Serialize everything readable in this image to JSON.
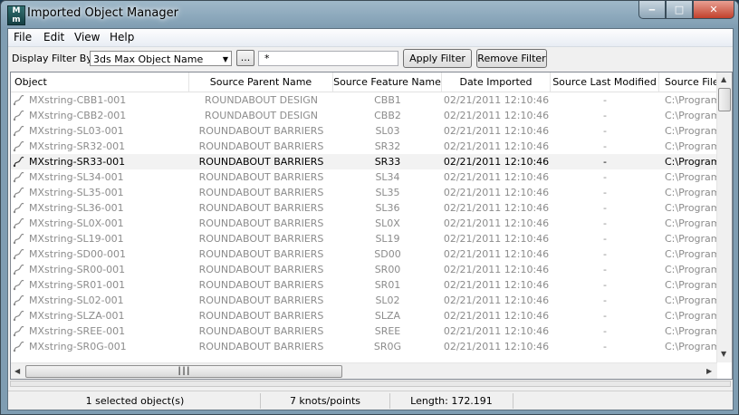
{
  "window": {
    "title": "Imported Object Manager"
  },
  "menu": [
    "File",
    "Edit",
    "View",
    "Help"
  ],
  "toolbar": {
    "filter_label": "Display Filter By:",
    "filter_by_value": "3ds Max Object Name",
    "browse_label": "...",
    "filter_text": "*",
    "apply_label": "Apply Filter",
    "remove_label": "Remove Filter"
  },
  "table": {
    "columns": [
      "Object",
      "Source Parent Name",
      "Source Feature Name",
      "Date Imported",
      "Source Last Modified",
      "Source File"
    ],
    "rows": [
      {
        "object": "MXstring-CBB1-001",
        "parent": "ROUNDABOUT DESIGN",
        "feature": "CBB1",
        "date": "02/21/2011 12:10:46",
        "modified": "-",
        "file": "C:\\Program"
      },
      {
        "object": "MXstring-CBB2-001",
        "parent": "ROUNDABOUT DESIGN",
        "feature": "CBB2",
        "date": "02/21/2011 12:10:46",
        "modified": "-",
        "file": "C:\\Program"
      },
      {
        "object": "MXstring-SL03-001",
        "parent": "ROUNDABOUT BARRIERS",
        "feature": "SL03",
        "date": "02/21/2011 12:10:46",
        "modified": "-",
        "file": "C:\\Program"
      },
      {
        "object": "MXstring-SR32-001",
        "parent": "ROUNDABOUT BARRIERS",
        "feature": "SR32",
        "date": "02/21/2011 12:10:46",
        "modified": "-",
        "file": "C:\\Program"
      },
      {
        "object": "MXstring-SR33-001",
        "parent": "ROUNDABOUT BARRIERS",
        "feature": "SR33",
        "date": "02/21/2011 12:10:46",
        "modified": "-",
        "file": "C:\\Program",
        "selected": true
      },
      {
        "object": "MXstring-SL34-001",
        "parent": "ROUNDABOUT BARRIERS",
        "feature": "SL34",
        "date": "02/21/2011 12:10:46",
        "modified": "-",
        "file": "C:\\Program"
      },
      {
        "object": "MXstring-SL35-001",
        "parent": "ROUNDABOUT BARRIERS",
        "feature": "SL35",
        "date": "02/21/2011 12:10:46",
        "modified": "-",
        "file": "C:\\Program"
      },
      {
        "object": "MXstring-SL36-001",
        "parent": "ROUNDABOUT BARRIERS",
        "feature": "SL36",
        "date": "02/21/2011 12:10:46",
        "modified": "-",
        "file": "C:\\Program"
      },
      {
        "object": "MXstring-SL0X-001",
        "parent": "ROUNDABOUT BARRIERS",
        "feature": "SL0X",
        "date": "02/21/2011 12:10:46",
        "modified": "-",
        "file": "C:\\Program"
      },
      {
        "object": "MXstring-SL19-001",
        "parent": "ROUNDABOUT BARRIERS",
        "feature": "SL19",
        "date": "02/21/2011 12:10:46",
        "modified": "-",
        "file": "C:\\Program"
      },
      {
        "object": "MXstring-SD00-001",
        "parent": "ROUNDABOUT BARRIERS",
        "feature": "SD00",
        "date": "02/21/2011 12:10:46",
        "modified": "-",
        "file": "C:\\Program"
      },
      {
        "object": "MXstring-SR00-001",
        "parent": "ROUNDABOUT BARRIERS",
        "feature": "SR00",
        "date": "02/21/2011 12:10:46",
        "modified": "-",
        "file": "C:\\Program"
      },
      {
        "object": "MXstring-SR01-001",
        "parent": "ROUNDABOUT BARRIERS",
        "feature": "SR01",
        "date": "02/21/2011 12:10:46",
        "modified": "-",
        "file": "C:\\Program"
      },
      {
        "object": "MXstring-SL02-001",
        "parent": "ROUNDABOUT BARRIERS",
        "feature": "SL02",
        "date": "02/21/2011 12:10:46",
        "modified": "-",
        "file": "C:\\Program"
      },
      {
        "object": "MXstring-SLZA-001",
        "parent": "ROUNDABOUT BARRIERS",
        "feature": "SLZA",
        "date": "02/21/2011 12:10:46",
        "modified": "-",
        "file": "C:\\Program"
      },
      {
        "object": "MXstring-SREE-001",
        "parent": "ROUNDABOUT BARRIERS",
        "feature": "SREE",
        "date": "02/21/2011 12:10:46",
        "modified": "-",
        "file": "C:\\Program"
      },
      {
        "object": "MXstring-SR0G-001",
        "parent": "ROUNDABOUT BARRIERS",
        "feature": "SR0G",
        "date": "02/21/2011 12:10:46",
        "modified": "-",
        "file": "C:\\Program"
      }
    ]
  },
  "status": {
    "selected": "1 selected object(s)",
    "knots": "7 knots/points",
    "length": "Length: 172.191"
  },
  "icons": {
    "app": "3ds-max-app-icon",
    "row": "spline-object-icon",
    "minimize": "minimize-icon",
    "maximize": "maximize-icon",
    "close": "close-icon"
  },
  "colors": {
    "title_bar": "#8fa9bc",
    "selected_row_text": "#000000",
    "dimmed_row_text": "#8c8c8c",
    "close_button": "#c2412c"
  }
}
